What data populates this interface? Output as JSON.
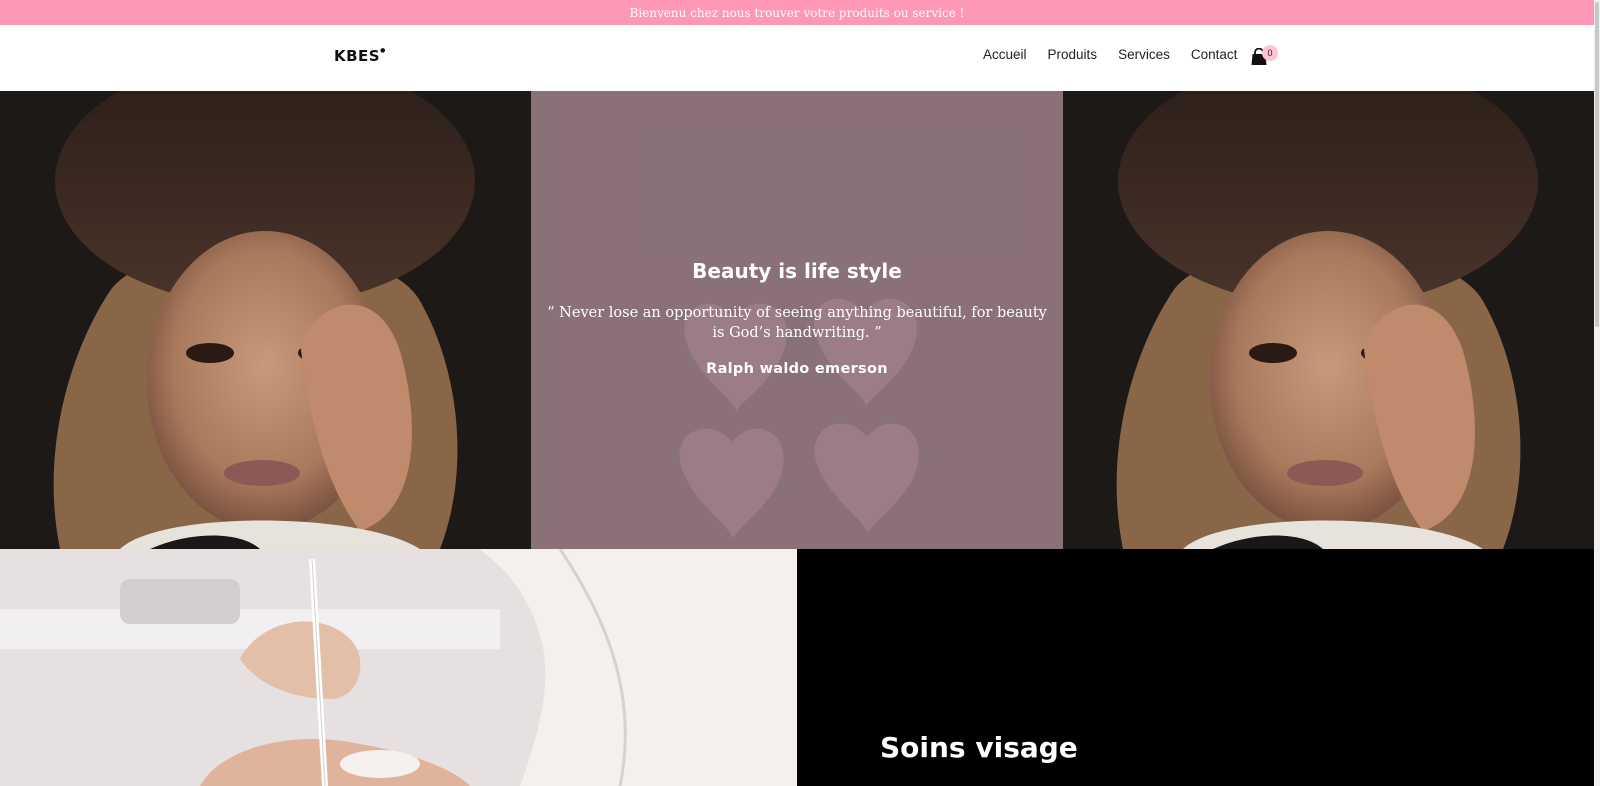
{
  "announcement": {
    "text": "Bienvenu chez nous trouver votre produits ou service !"
  },
  "header": {
    "logo": "KBES",
    "nav": [
      {
        "label": "Accueil"
      },
      {
        "label": "Produits"
      },
      {
        "label": "Services"
      },
      {
        "label": "Contact"
      }
    ],
    "cart": {
      "icon": "shopping-bag-icon",
      "count": "0"
    }
  },
  "hero": {
    "title": "Beauty is life style",
    "quote": "“ Never lose an opportunity of seeing anything beautiful, for beauty is God’s handwriting. ”",
    "author": "Ralph waldo emerson"
  },
  "section": {
    "title": "Soins visage"
  },
  "colors": {
    "topbar": "#ff97b6",
    "badge": "#ffc3d4",
    "overlay": "#5a5056",
    "dark": "#000000"
  }
}
